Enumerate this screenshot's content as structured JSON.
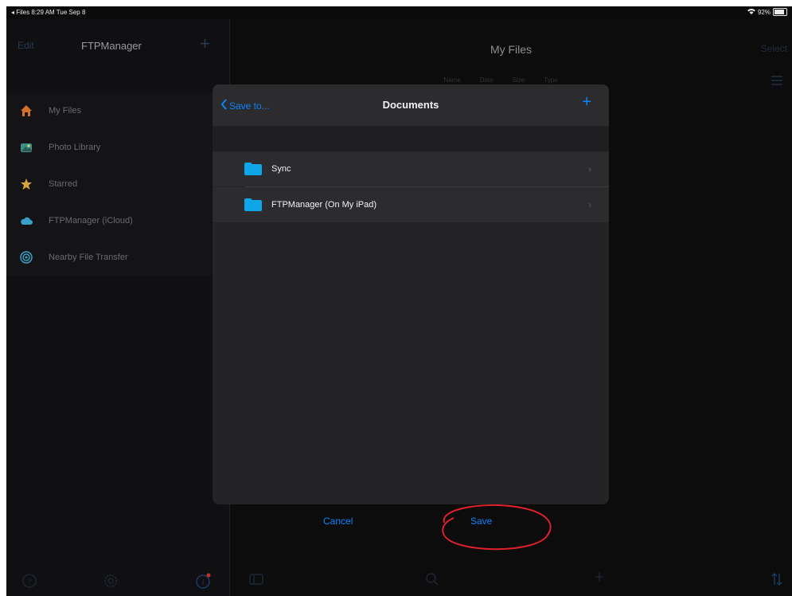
{
  "status_bar": {
    "left_text": "◂ Files  8:29 AM  Tue Sep 8",
    "right_text": "92%"
  },
  "sidebar": {
    "edit_label": "Edit",
    "title": "FTPManager",
    "items": [
      {
        "label": "My Files",
        "icon": "house-icon",
        "color": "#d4702a"
      },
      {
        "label": "Photo Library",
        "icon": "photo-library-icon",
        "color": "#3a8f8a"
      },
      {
        "label": "Starred",
        "icon": "star-icon",
        "color": "#d9a23a"
      },
      {
        "label": "FTPManager (iCloud)",
        "icon": "cloud-icon",
        "color": "#3aa0c8"
      },
      {
        "label": "Nearby File Transfer",
        "icon": "wireless-icon",
        "color": "#3aa0c8"
      }
    ]
  },
  "main": {
    "title": "My Files",
    "select_label": "Select",
    "sort_options": [
      "Name",
      "Date",
      "Size",
      "Type"
    ]
  },
  "modal": {
    "back_label": "Save to...",
    "title": "Documents",
    "folders": [
      {
        "label": "Sync"
      },
      {
        "label": "FTPManager (On My iPad)"
      }
    ]
  },
  "actions": {
    "cancel_label": "Cancel",
    "save_label": "Save"
  },
  "colors": {
    "accent": "#0a84ff",
    "annotation": "#e0202a",
    "folder": "#0ea5e9"
  }
}
